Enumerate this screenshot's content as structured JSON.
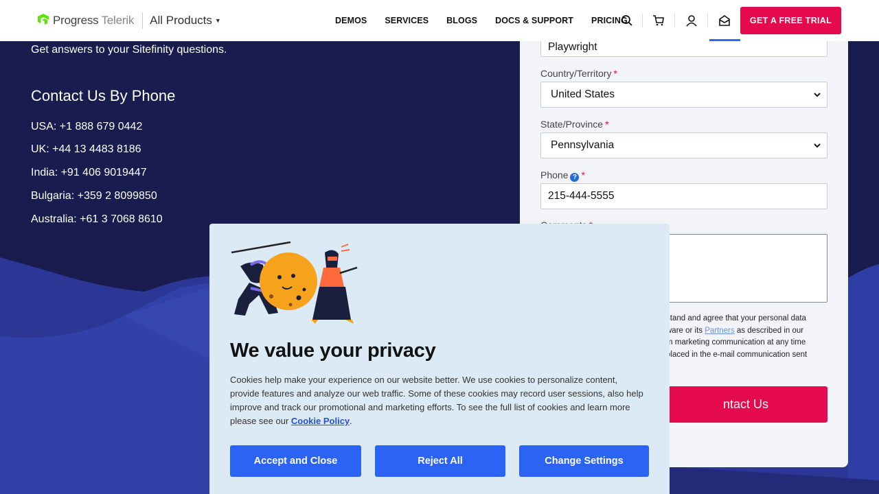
{
  "header": {
    "logo_primary": "Progress",
    "logo_secondary": "Telerik",
    "all_products": "All Products",
    "nav": [
      "DEMOS",
      "SERVICES",
      "BLOGS",
      "DOCS & SUPPORT",
      "PRICING"
    ],
    "trial_button": "GET A FREE TRIAL",
    "icons": [
      "search-icon",
      "cart-icon",
      "user-icon",
      "mail-icon"
    ]
  },
  "left": {
    "answers_text": "Get answers to your Sitefinity questions.",
    "phone_title": "Contact Us By Phone",
    "phones": [
      "USA: +1 888 679 0442",
      "UK: +44 13 4483 8186",
      "India: +91 406 9019447",
      "Bulgaria: +359 2 8099850",
      "Australia: +61 3 7068 8610"
    ]
  },
  "form": {
    "company_value": "Playwright",
    "country_label": "Country/Territory",
    "country_value": "United States",
    "state_label": "State/Province",
    "state_value": "Pennsylvania",
    "phone_label": "Phone",
    "phone_help": "?",
    "phone_value": "215-444-5555",
    "comments_label": "Comments",
    "required_mark": "*",
    "consent_line1": "stand and agree that your personal data",
    "consent_line2_pre": "ware or its ",
    "consent_partners": "Partners",
    "consent_line2_post": " as described in our",
    "consent_line3": "m marketing communication at any time",
    "consent_line4": "placed in the e-mail communication sent",
    "submit_label": "ntact Us"
  },
  "cookie": {
    "title": "We value your privacy",
    "body": "Cookies help make your experience on our website better. We use cookies to personalize content, provide features and analyze our web traffic. Some of these cookies may record user sessions, also help improve and track our promotional and marketing efforts. To see the full list of cookies and learn more please see our ",
    "policy_link": "Cookie Policy",
    "body_end": ".",
    "accept": "Accept and Close",
    "reject": "Reject All",
    "settings": "Change Settings"
  },
  "colors": {
    "brand_pink": "#e5094e",
    "page_bg": "#181c4f",
    "cookie_btn": "#2b64f5",
    "cookie_bg": "#dceaf5"
  }
}
